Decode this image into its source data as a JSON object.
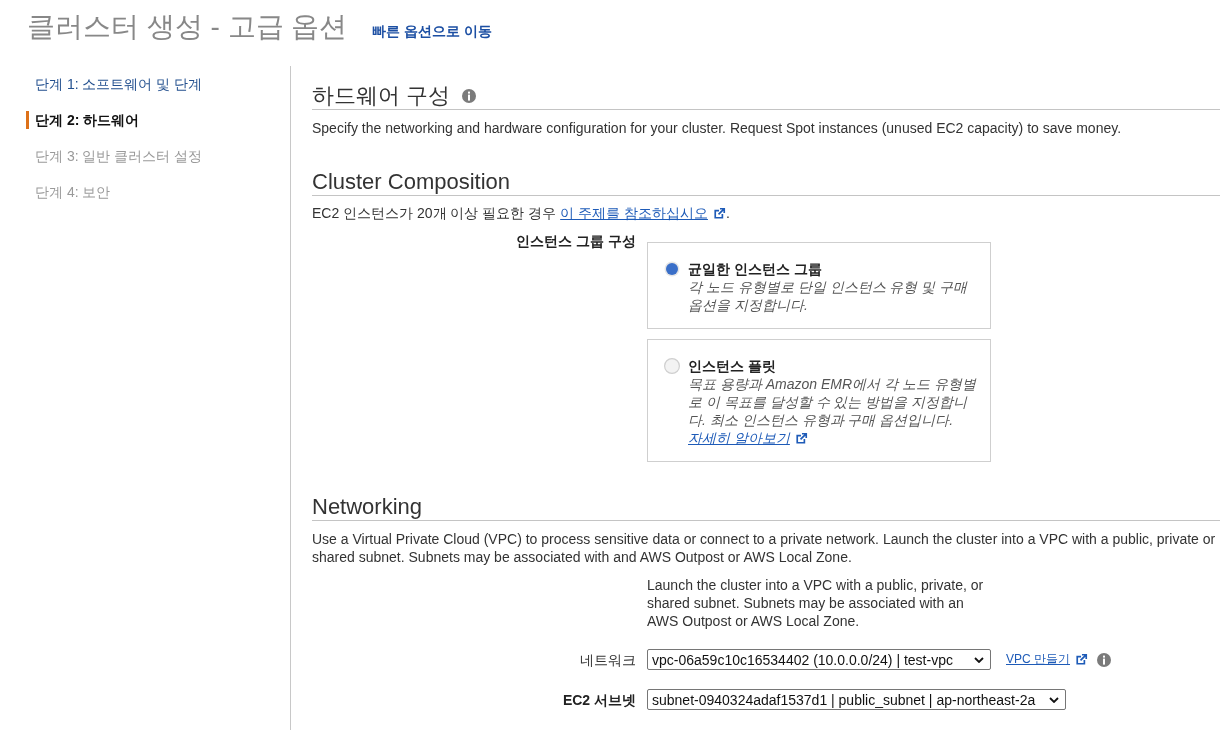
{
  "header": {
    "title": "클러스터 생성 - 고급 옵션",
    "quick_link": "빠른 옵션으로 이동"
  },
  "steps": [
    {
      "label": "단계 1: 소프트웨어 및 단계",
      "selected": false,
      "disabled": false
    },
    {
      "label": "단계 2: 하드웨어",
      "selected": true,
      "disabled": false
    },
    {
      "label": "단계 3: 일반 클러스터 설정",
      "selected": false,
      "disabled": true
    },
    {
      "label": "단계 4: 보안",
      "selected": false,
      "disabled": true
    }
  ],
  "hardware": {
    "heading": "하드웨어 구성",
    "description": "Specify the networking and hardware configuration for your cluster. Request Spot instances (unused EC2 capacity) to save money."
  },
  "cluster_composition": {
    "heading": "Cluster Composition",
    "note": {
      "text": "EC2 인스턴스가 20개 이상 필요한 경우",
      "link": "이 주제를 참조하십시오",
      "after": "."
    },
    "group_label": "인스턴스 그룹 구성",
    "options": [
      {
        "title": "균일한 인스턴스 그룹",
        "description": "각 노드 유형별로 단일 인스턴스 유형 및 구매 옵션을 지정합니다.",
        "selected": true
      },
      {
        "title": "인스턴스 플릿",
        "description": "목표 용량과 Amazon EMR에서 각 노드 유형별로 이 목표를 달성할 수 있는 방법을 지정합니다. 최소 인스턴스 유형과 구매 옵션입니다.",
        "link": "자세히 알아보기",
        "selected": false
      }
    ]
  },
  "networking": {
    "heading": "Networking",
    "description": "Use a Virtual Private Cloud (VPC) to process sensitive data or connect to a private network. Launch the cluster into a VPC with a public, private or shared subnet. Subnets may be associated with and AWS Outpost or AWS Local Zone.",
    "help": "Launch the cluster into a VPC with a public, private, or shared subnet. Subnets may be associated with an AWS Outpost or AWS Local Zone.",
    "fields": [
      {
        "label": "네트워크",
        "value": "vpc-06a59c10c16534402 (10.0.0.0/24) | test-vpc",
        "required": false,
        "link": "VPC 만들기",
        "info": true
      },
      {
        "label": "EC2 서브넷",
        "value": "subnet-0940324adaf1537d1 | public_subnet | ap-northeast-2a",
        "required": true,
        "info": false
      }
    ]
  }
}
